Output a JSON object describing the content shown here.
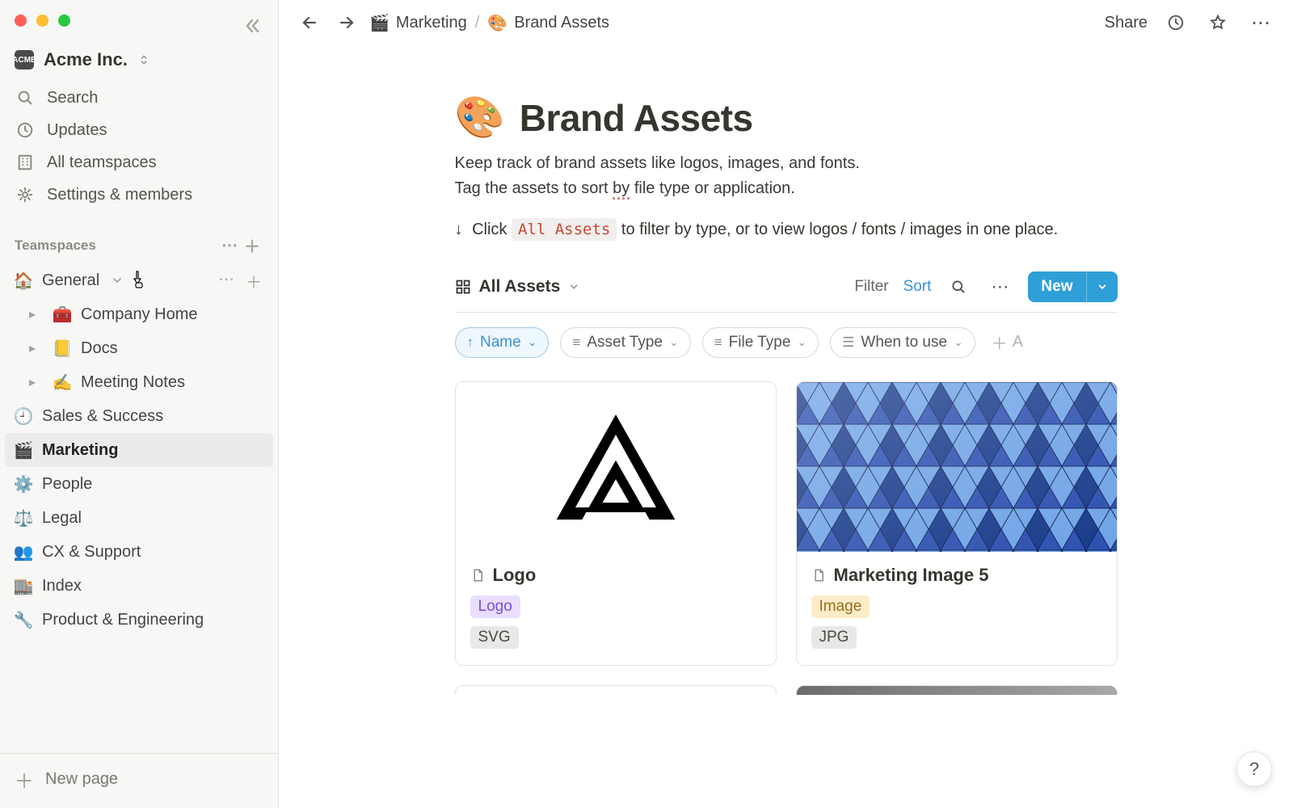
{
  "workspace": {
    "name": "Acme Inc.",
    "logo_text": "ACME"
  },
  "nav": {
    "search": "Search",
    "updates": "Updates",
    "all_teamspaces": "All teamspaces",
    "settings": "Settings & members"
  },
  "teamspaces_header": "Teamspaces",
  "teamspaces": [
    {
      "icon": "🏠",
      "label": "General",
      "hover": true,
      "children": [
        {
          "icon": "🧰",
          "label": "Company Home"
        },
        {
          "icon": "📒",
          "label": "Docs"
        },
        {
          "icon": "✍️",
          "label": "Meeting Notes"
        }
      ]
    },
    {
      "icon": "🕘",
      "label": "Sales & Success"
    },
    {
      "icon": "🎬",
      "label": "Marketing",
      "selected": true
    },
    {
      "icon": "⚙️",
      "label": "People"
    },
    {
      "icon": "⚖️",
      "label": "Legal"
    },
    {
      "icon": "👥",
      "label": "CX & Support"
    },
    {
      "icon": "🏬",
      "label": "Index"
    },
    {
      "icon": "🔧",
      "label": "Product & Engineering"
    }
  ],
  "new_page": "New page",
  "breadcrumbs": [
    {
      "icon": "🎬",
      "label": "Marketing"
    },
    {
      "icon": "🎨",
      "label": "Brand Assets"
    }
  ],
  "topbar": {
    "share": "Share"
  },
  "page": {
    "icon": "🎨",
    "title": "Brand Assets",
    "subtitle_l1": "Keep track of brand assets like logos, images, and fonts.",
    "subtitle_l2_a": "Tag the assets to sort ",
    "subtitle_l2_by": "by",
    "subtitle_l2_b": " file type or application.",
    "tip_arrow": "↓",
    "tip_a": "Click ",
    "tip_code": "All Assets",
    "tip_b": " to filter by type, or to view logos / fonts / images in one place."
  },
  "view": {
    "name": "All Assets"
  },
  "toolbar": {
    "filter": "Filter",
    "sort": "Sort",
    "new": "New"
  },
  "props": {
    "name": "Name",
    "asset_type": "Asset Type",
    "file_type": "File Type",
    "when": "When to use",
    "add_placeholder": "A"
  },
  "cards": [
    {
      "title": "Logo",
      "asset_type": "Logo",
      "asset_color": "purple",
      "file_type": "SVG"
    },
    {
      "title": "Marketing Image 5",
      "asset_type": "Image",
      "asset_color": "yellow",
      "file_type": "JPG"
    }
  ],
  "help": "?"
}
